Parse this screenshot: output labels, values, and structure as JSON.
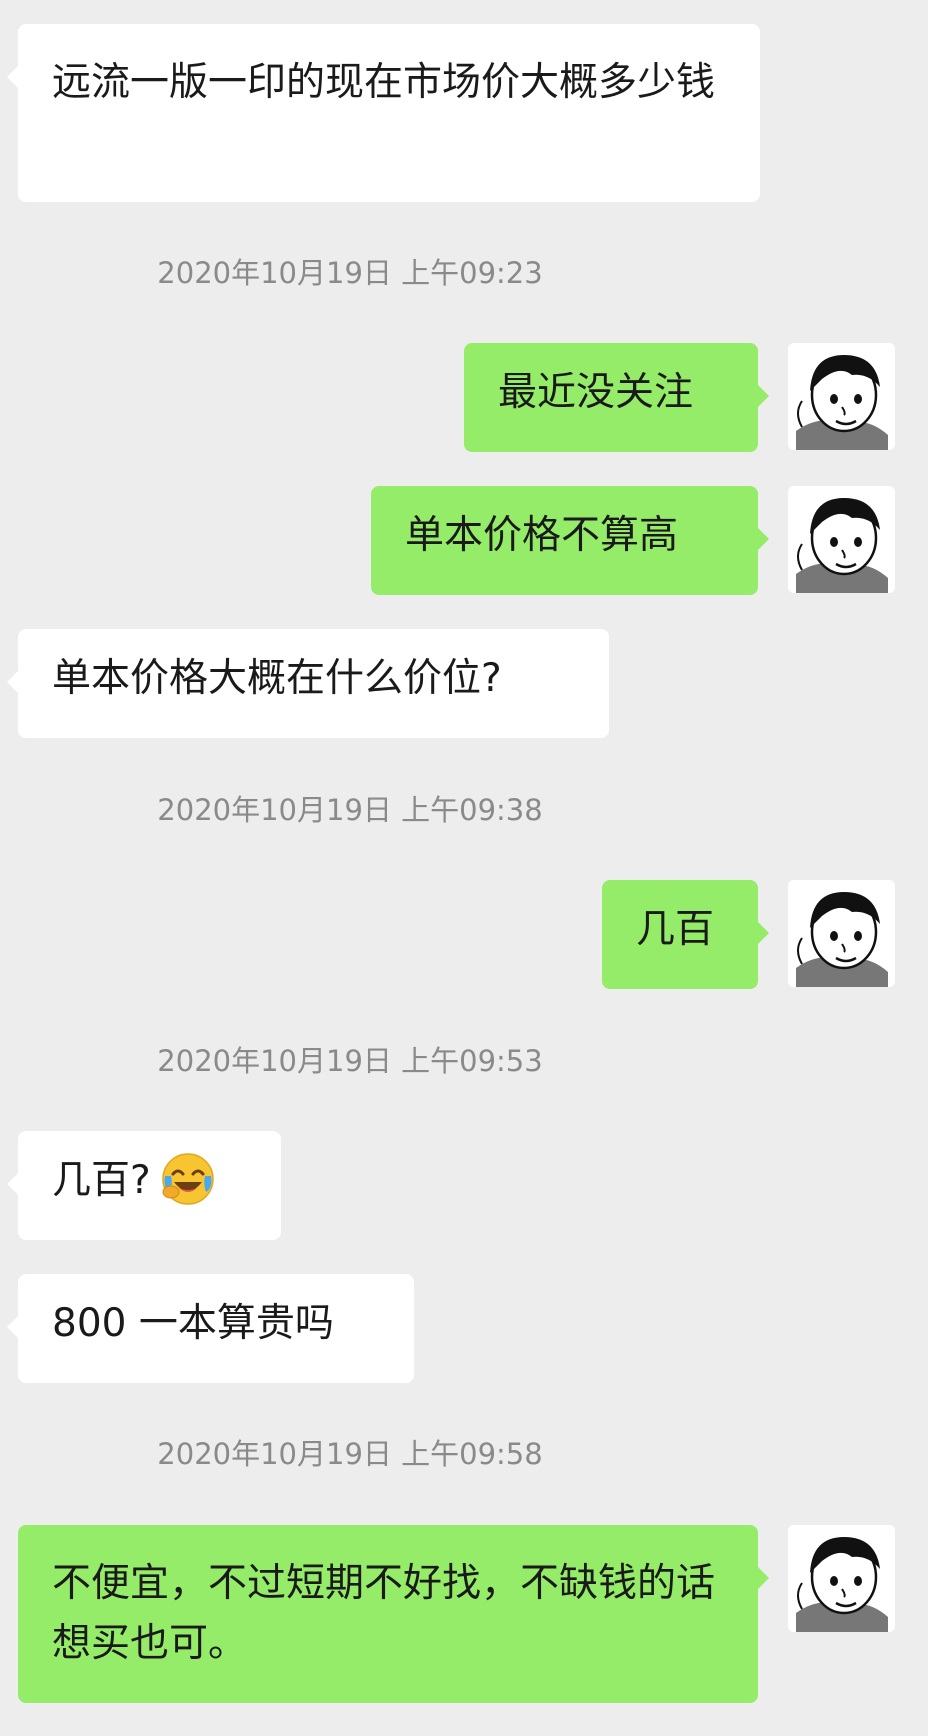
{
  "messages": [
    {
      "side": "in",
      "text": "远流一版一印的现在市场价大概多少钱"
    },
    {
      "timestamp": "2020年10月19日 上午09:23"
    },
    {
      "side": "out",
      "text": "最近没关注"
    },
    {
      "side": "out",
      "text": "单本价格不算高"
    },
    {
      "side": "in",
      "text": "单本价格大概在什么价位?"
    },
    {
      "timestamp": "2020年10月19日 上午09:38"
    },
    {
      "side": "out",
      "text": "几百"
    },
    {
      "timestamp": "2020年10月19日 上午09:53"
    },
    {
      "side": "in",
      "text": "几百?",
      "emoji": "laughing-crying-emoji"
    },
    {
      "side": "in",
      "text": "800 一本算贵吗"
    },
    {
      "timestamp": "2020年10月19日 上午09:58"
    },
    {
      "side": "out",
      "text": "不便宜，不过短期不好找，不缺钱的话想买也可。"
    }
  ],
  "colors": {
    "background": "#ededed",
    "incoming_bubble": "#ffffff",
    "outgoing_bubble": "#95ec69",
    "timestamp_text": "#8a8a8a"
  },
  "icons": {
    "avatar": "cartoon-boy-avatar",
    "emoji": "laughing-crying-emoji"
  }
}
